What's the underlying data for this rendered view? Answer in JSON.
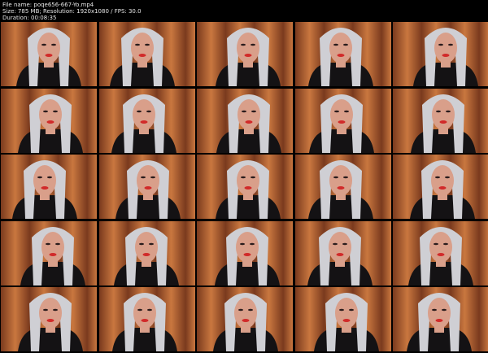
{
  "header": {
    "file_name": "File name: poqe656-667-Yo.mp4",
    "size_line": "Size: 785 MB; Resolution: 1920x1080 / FPS: 30.0",
    "duration": "Duration: 00:08:35"
  },
  "thumbnails": {
    "count": 25,
    "columns": 5,
    "rows": 5,
    "colors": {
      "curtain_dark": "#7a3a1e",
      "curtain_light": "#c9773f",
      "hair": "#cfcfd4",
      "skin": "#d99f8a",
      "top": "#141214",
      "lips": "#d12a2a"
    }
  }
}
